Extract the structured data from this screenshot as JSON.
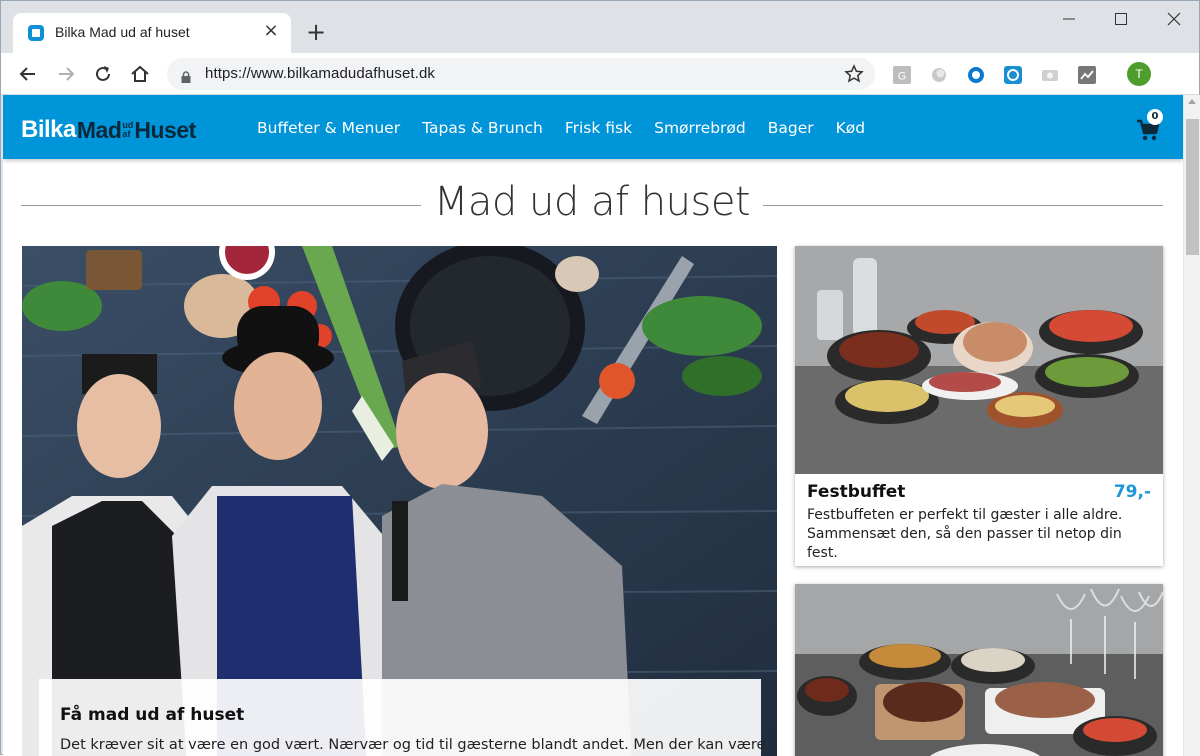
{
  "browser": {
    "tab_title": "Bilka Mad ud af huset",
    "tab_close": "×",
    "new_tab": "+",
    "url": "https://www.bilkamadudafhuset.dk",
    "profile_initial": "T",
    "window_controls": [
      "minimize-icon",
      "maximize-icon",
      "close-icon"
    ]
  },
  "site": {
    "logo": {
      "part1": "Bilka",
      "part2": "Mad",
      "part3a": "ud",
      "part3b": "af",
      "part4": "Huset"
    },
    "nav": [
      "Buffeter & Menuer",
      "Tapas & Brunch",
      "Frisk fisk",
      "Smørrebrød",
      "Bager",
      "Kød"
    ],
    "cart_count": "0",
    "accent_color": "#0094d8",
    "price_color": "#1e95d4"
  },
  "main": {
    "page_title": "Mad ud af huset",
    "hero": {
      "title": "Få mad ud af huset",
      "text": "Det kræver sit at være en god vært. Nærvær og tid til gæsterne blandt andet. Men der kan være"
    },
    "products": [
      {
        "name": "Festbuffet",
        "price": "79,-",
        "description": "Festbuffeten er perfekt til gæster i alle aldre. Sammensæt den, så den passer til netop din fest."
      }
    ]
  }
}
